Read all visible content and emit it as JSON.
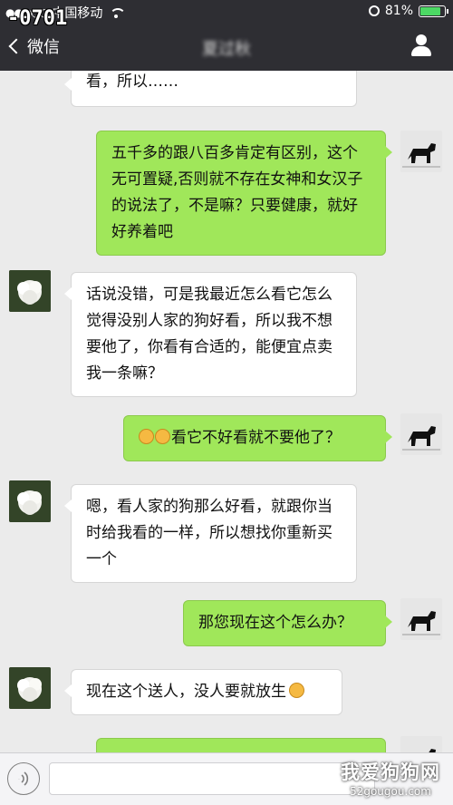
{
  "status_bar": {
    "carrier": "中国移动",
    "overlay_number": "-0701",
    "battery": "81%",
    "battery_level": 0.81
  },
  "nav": {
    "back_label": "微信",
    "title": "夏过秋"
  },
  "messages": [
    {
      "side": "left",
      "text": "看，所以……"
    },
    {
      "side": "right",
      "text": "五千多的跟八百多肯定有区别，这个无可置疑,否则就不存在女神和女汉子的说法了，不是嘛？只要健康，就好好养着吧"
    },
    {
      "side": "left",
      "text": "话说没错，可是我最近怎么看它怎么觉得没别人家的狗好看，所以我不想要他了，你看有合适的，能便宜点卖我一条嘛？"
    },
    {
      "side": "right",
      "text": "看它不好看就不要他了？"
    },
    {
      "side": "left",
      "text": "嗯，看人家的狗那么好看，就跟你当时给我看的一样，所以想找你重新买一个"
    },
    {
      "side": "right",
      "text": "那您现在这个怎么办？"
    },
    {
      "side": "left",
      "text": "现在这个送人，没人要就放生"
    }
  ],
  "watermark": {
    "line1": "我爱狗狗网",
    "line2": "52gougou.com"
  },
  "icons": {
    "back": "chevron-left-icon",
    "profile": "person-icon",
    "voice": "voice-icon",
    "emoji": "smiley-emoji-icon"
  },
  "colors": {
    "nav_bg": "#2e2e33",
    "chat_bg": "#ebebeb",
    "bubble_right": "#a0e75a",
    "bubble_left": "#ffffff"
  }
}
